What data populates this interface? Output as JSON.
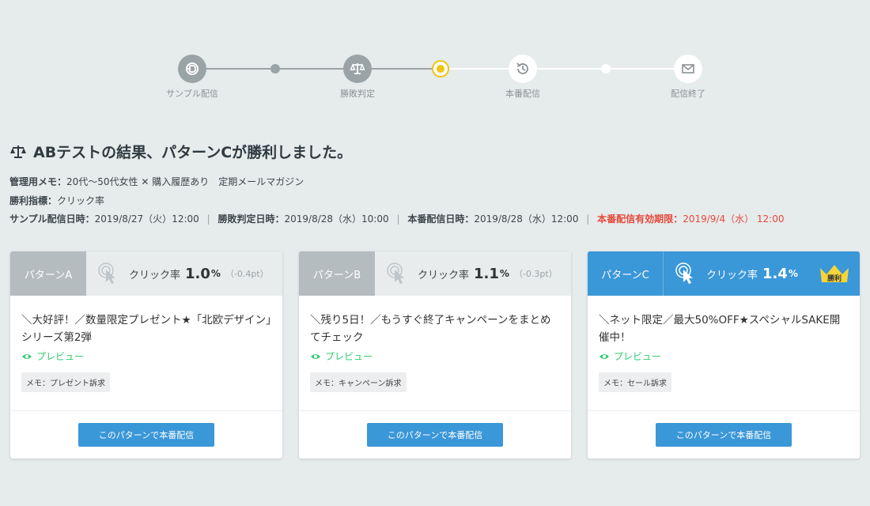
{
  "colors": {
    "accent": "#3a97d8",
    "done_step": "#9aa3a6",
    "current_step": "#f1c40f",
    "preview_green": "#2ecc71",
    "warning_red": "#e5493a"
  },
  "stepper": {
    "steps": [
      {
        "label": "サンプル配信",
        "icon": "sample-send-icon",
        "state": "done"
      },
      {
        "label": "勝敗判定",
        "icon": "scale-icon",
        "state": "done"
      },
      {
        "label": "本番配信",
        "icon": "history-icon",
        "state": "todo"
      },
      {
        "label": "配信終了",
        "icon": "mail-icon",
        "state": "todo"
      }
    ],
    "current_index": 2
  },
  "result": {
    "title": "ABテストの結果、パターンCが勝利しました。",
    "memo_label": "管理用メモ：",
    "memo_value": "20代〜50代女性 ✕ 購入履歴あり　定期メールマガジン",
    "metric_label": "勝利指標：",
    "metric_value": "クリック率",
    "sample_label": "サンプル配信日時：",
    "sample_value": "2019/8/27（火）12:00",
    "judge_label": "勝敗判定日時：",
    "judge_value": "2019/8/28（水）10:00",
    "prod_label": "本番配信日時：",
    "prod_value": "2019/8/28（水）12:00",
    "expire_label": "本番配信有効期限：",
    "expire_value": "2019/9/4（水） 12:00"
  },
  "patterns": [
    {
      "name": "パターンA",
      "rate_label": "クリック率",
      "rate": "1.0",
      "unit": "%",
      "diff": "（-0.4pt）",
      "copy": "＼大好評！／数量限定プレゼント★「北欧デザイン」シリーズ第2弾",
      "preview": "プレビュー",
      "memo": "メモ：プレゼント訴求",
      "button": "このパターンで本番配信"
    },
    {
      "name": "パターンB",
      "rate_label": "クリック率",
      "rate": "1.1",
      "unit": "%",
      "diff": "（-0.3pt）",
      "copy": "＼残り5日！／もうすぐ終了キャンペーンをまとめてチェック",
      "preview": "プレビュー",
      "memo": "メモ：キャンペーン訴求",
      "button": "このパターンで本番配信"
    },
    {
      "name": "パターンC",
      "rate_label": "クリック率",
      "rate": "1.4",
      "unit": "%",
      "diff": "",
      "winner_badge": "勝利",
      "copy": "＼ネット限定／最大50%OFF★スペシャルSAKE開催中！",
      "preview": "プレビュー",
      "memo": "メモ：セール訴求",
      "button": "このパターンで本番配信"
    }
  ]
}
